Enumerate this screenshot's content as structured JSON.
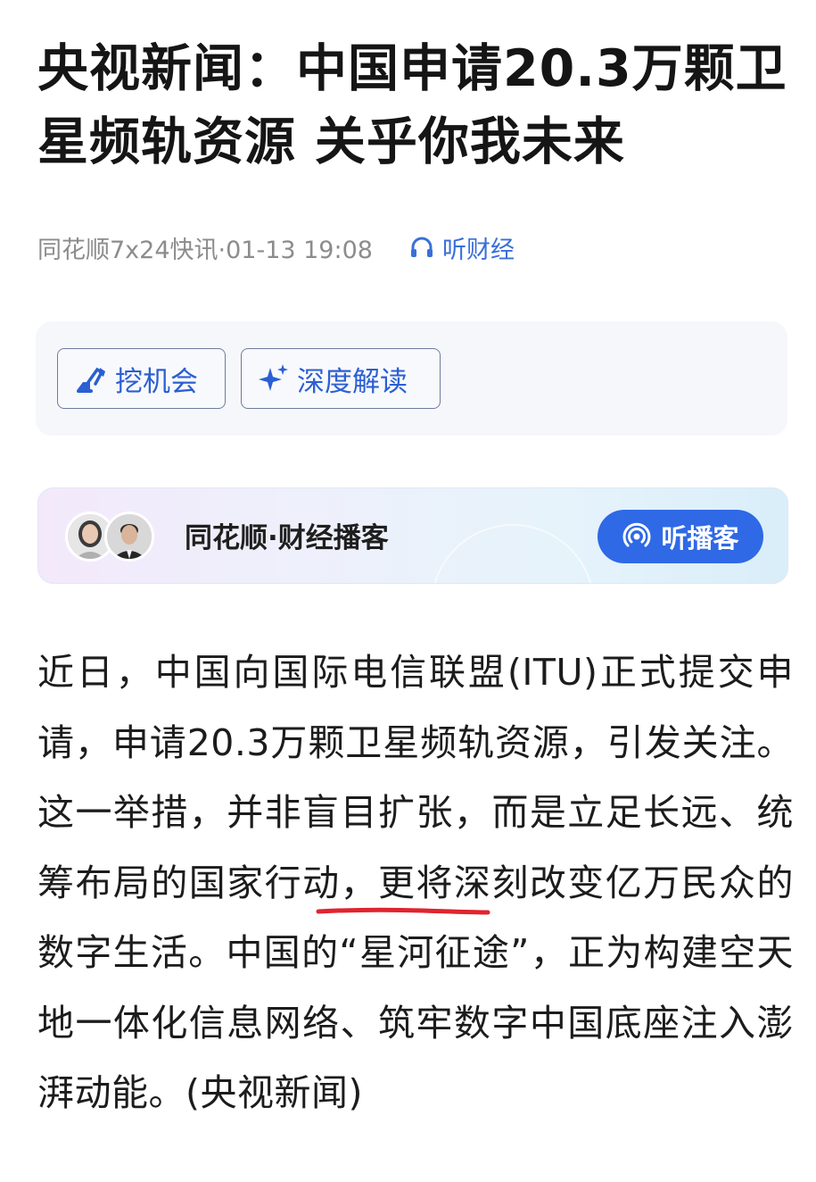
{
  "article": {
    "title": "央视新闻：中国申请20.3万颗卫星频轨资源 关乎你我未来",
    "source_time": "同花顺7x24快讯·01-13 19:08",
    "listen_label": "听财经"
  },
  "tools": {
    "opportunity_label": "挖机会",
    "deep_read_label": "深度解读"
  },
  "podcast": {
    "name": "同花顺·财经播客",
    "button_label": "听播客"
  },
  "body": {
    "paragraph": "近日，中国向国际电信联盟(ITU)正式提交申请，申请20.3万颗卫星频轨资源，引发关注。这一举措，并非盲目扩张，而是立足长远、统筹布局的国家行动，更将深刻改变亿万民众的数字生活。中国的“星河征途”，正为构建空天地一体化信息网络、筑牢数字中国底座注入澎湃动能。(央视新闻)"
  },
  "colors": {
    "accent": "#2f69e6",
    "link": "#3a6fd8",
    "underline": "#e0242f"
  },
  "icons": [
    "headphones-icon",
    "excavator-icon",
    "sparkle-icon",
    "podcast-signal-icon"
  ]
}
